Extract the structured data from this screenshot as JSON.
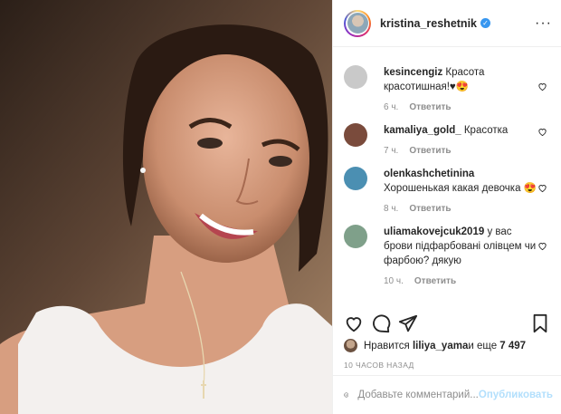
{
  "post": {
    "username": "kristina_reshetnik",
    "more_icon": "ellipsis-icon",
    "verified_icon": "verified-badge-icon"
  },
  "comments": [
    {
      "username": "kesincengiz",
      "text": "Красота красотишная!♥😍",
      "time": "6 ч.",
      "reply": "Ответить",
      "avatar_color": "#c9c9c9"
    },
    {
      "username": "kamaliya_gold_",
      "text": "Красотка",
      "time": "7 ч.",
      "reply": "Ответить",
      "avatar_color": "#7a4b3c"
    },
    {
      "username": "olenkashchetinina",
      "text": "Хорошенькая какая девочка 😍",
      "time": "8 ч.",
      "reply": "Ответить",
      "avatar_color": "#4b8fb2"
    },
    {
      "username": "uliamakovejcuk2019",
      "text": "у вас брови підфарбовані олівцем чи фарбою? дякую",
      "time": "10 ч.",
      "reply": "Ответить",
      "avatar_color": "#7fa08a"
    }
  ],
  "likes": {
    "prefix": "Нравится ",
    "user": "liliya_yama",
    "middle": " и еще ",
    "count": "7 497"
  },
  "timestamp": "10 ЧАСОВ НАЗАД",
  "add_comment": {
    "placeholder": "Добавьте комментарий...",
    "publish": "Опубликовать"
  }
}
